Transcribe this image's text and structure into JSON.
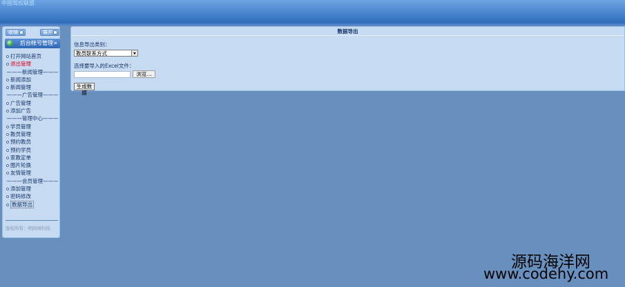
{
  "header": {
    "title": "中国驾校联盟"
  },
  "sidebar": {
    "buttons": {
      "left": "收缩",
      "right": "展开"
    },
    "menu_title": "后台帐号管理",
    "menu_title_arrows": "»",
    "items": [
      {
        "type": "link",
        "label": "打开网站首页"
      },
      {
        "type": "link",
        "label": "退出管理",
        "color": "#e2001a"
      },
      {
        "type": "section",
        "label": "———新闻管理———"
      },
      {
        "type": "link",
        "label": "新闻添加"
      },
      {
        "type": "link",
        "label": "新闻管理"
      },
      {
        "type": "section",
        "label": "———广告管理———"
      },
      {
        "type": "link",
        "label": "广告管理"
      },
      {
        "type": "link",
        "label": "添加广告"
      },
      {
        "type": "section",
        "label": "———管理中心———"
      },
      {
        "type": "link",
        "label": "学员管理"
      },
      {
        "type": "link",
        "label": "教员管理"
      },
      {
        "type": "link",
        "label": "预约教员"
      },
      {
        "type": "link",
        "label": "预约学员"
      },
      {
        "type": "link",
        "label": "家教定单"
      },
      {
        "type": "link",
        "label": "图片轮换"
      },
      {
        "type": "link",
        "label": "友情管理"
      },
      {
        "type": "section",
        "label": "———会员管理———"
      },
      {
        "type": "link",
        "label": "添加管理"
      },
      {
        "type": "link",
        "label": "密码修改"
      },
      {
        "type": "link",
        "label": "数据导出",
        "selected": true
      }
    ],
    "footer": "版权所有：明网络科技"
  },
  "main": {
    "title": "数据导出",
    "type_label": "信息导出类别：",
    "type_select_value": "教员联系方式",
    "file_label": "选择要导入的Excel文件：",
    "browse_label": "浏览...",
    "generate_label": "生成数据"
  },
  "watermark": {
    "cn": "源码海洋网",
    "en": "www.codehy.com"
  }
}
